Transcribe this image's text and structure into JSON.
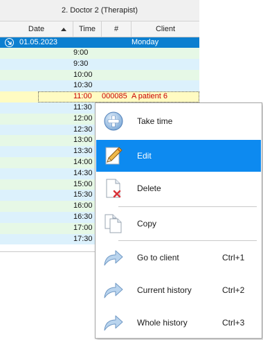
{
  "grid": {
    "doctor_header": "2. Doctor 2 (Therapist)",
    "columns": [
      "Date",
      "Time",
      "#",
      "Client"
    ],
    "group": {
      "date": "01.05.2023",
      "day": "Monday"
    },
    "rows": [
      {
        "time": "9:00",
        "num": "",
        "client": ""
      },
      {
        "time": "9:30",
        "num": "",
        "client": ""
      },
      {
        "time": "10:00",
        "num": "",
        "client": ""
      },
      {
        "time": "10:30",
        "num": "",
        "client": ""
      },
      {
        "time": "11:00",
        "num": "000085",
        "client": "A patient 6"
      },
      {
        "time": "11:30",
        "num": "",
        "client": ""
      },
      {
        "time": "12:00",
        "num": "",
        "client": ""
      },
      {
        "time": "12:30",
        "num": "",
        "client": ""
      },
      {
        "time": "13:00",
        "num": "",
        "client": ""
      },
      {
        "time": "13:30",
        "num": "",
        "client": ""
      },
      {
        "time": "14:00",
        "num": "",
        "client": ""
      },
      {
        "time": "14:30",
        "num": "",
        "client": ""
      },
      {
        "time": "15:00",
        "num": "",
        "client": ""
      },
      {
        "time": "15:30",
        "num": "",
        "client": ""
      },
      {
        "time": "16:00",
        "num": "",
        "client": ""
      },
      {
        "time": "16:30",
        "num": "",
        "client": ""
      },
      {
        "time": "17:00",
        "num": "",
        "client": ""
      },
      {
        "time": "17:30",
        "num": "",
        "client": ""
      }
    ]
  },
  "context_menu": {
    "items": [
      {
        "label": "Take time",
        "shortcut": "",
        "icon": "plus-circle-icon"
      },
      {
        "label": "Edit",
        "shortcut": "",
        "icon": "edit-pencil-icon"
      },
      {
        "label": "Delete",
        "shortcut": "",
        "icon": "delete-document-icon"
      },
      {
        "label": "Copy",
        "shortcut": "",
        "icon": "copy-documents-icon"
      },
      {
        "label": "Go to client",
        "shortcut": "Ctrl+1",
        "icon": "arrow-right-icon"
      },
      {
        "label": "Current history",
        "shortcut": "Ctrl+2",
        "icon": "arrow-right-icon"
      },
      {
        "label": "Whole history",
        "shortcut": "Ctrl+3",
        "icon": "arrow-right-icon"
      }
    ]
  },
  "colors": {
    "group_row": "#0c7fd0",
    "row_green": "#e6f8e6",
    "row_blue": "#dcf1fc",
    "patient_row": "#fffbc2",
    "patient_text": "#c80000",
    "menu_selected": "#0d8af0"
  }
}
